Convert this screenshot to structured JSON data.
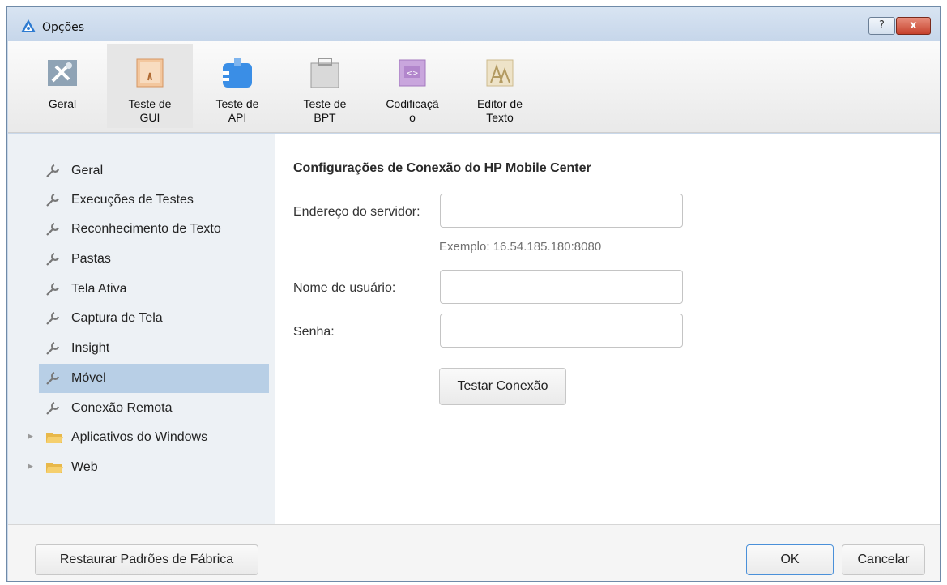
{
  "window": {
    "title": "Opções",
    "help_label": "?",
    "close_label": "x"
  },
  "toolbar": {
    "items": [
      {
        "label": "Geral",
        "icon": "tools-icon"
      },
      {
        "label": "Teste de\nGUI",
        "icon": "gui-test-icon"
      },
      {
        "label": "Teste de\nAPI",
        "icon": "api-test-icon"
      },
      {
        "label": "Teste de\nBPT",
        "icon": "bpt-test-icon"
      },
      {
        "label": "Codificaçã\no",
        "icon": "coding-icon"
      },
      {
        "label": "Editor de\nTexto",
        "icon": "text-editor-icon"
      }
    ],
    "selected_index": 1
  },
  "sidebar": {
    "items": [
      {
        "label": "Geral",
        "type": "leaf"
      },
      {
        "label": "Execuções de Testes",
        "type": "leaf"
      },
      {
        "label": "Reconhecimento de Texto",
        "type": "leaf"
      },
      {
        "label": "Pastas",
        "type": "leaf"
      },
      {
        "label": "Tela Ativa",
        "type": "leaf"
      },
      {
        "label": "Captura de Tela",
        "type": "leaf"
      },
      {
        "label": "Insight",
        "type": "leaf"
      },
      {
        "label": "Móvel",
        "type": "leaf",
        "selected": true
      },
      {
        "label": "Conexão Remota",
        "type": "leaf"
      },
      {
        "label": "Aplicativos do Windows",
        "type": "folder"
      },
      {
        "label": "Web",
        "type": "folder"
      }
    ]
  },
  "content": {
    "title": "Configurações de Conexão do HP Mobile Center",
    "server_label": "Endereço do servidor:",
    "server_value": "",
    "server_hint": "Exemplo: 16.54.185.180:8080",
    "username_label": "Nome de usuário:",
    "username_value": "",
    "password_label": "Senha:",
    "password_value": "",
    "test_button": "Testar Conexão"
  },
  "footer": {
    "restore_button": "Restaurar Padrões de Fábrica",
    "ok_button": "OK",
    "cancel_button": "Cancelar"
  },
  "colors": {
    "title_bar": "#c6d6ea",
    "selection": "#b8cfe6",
    "sidebar_bg": "#edf1f5",
    "close_button": "#c6412c",
    "ok_border": "#4a90d9"
  }
}
